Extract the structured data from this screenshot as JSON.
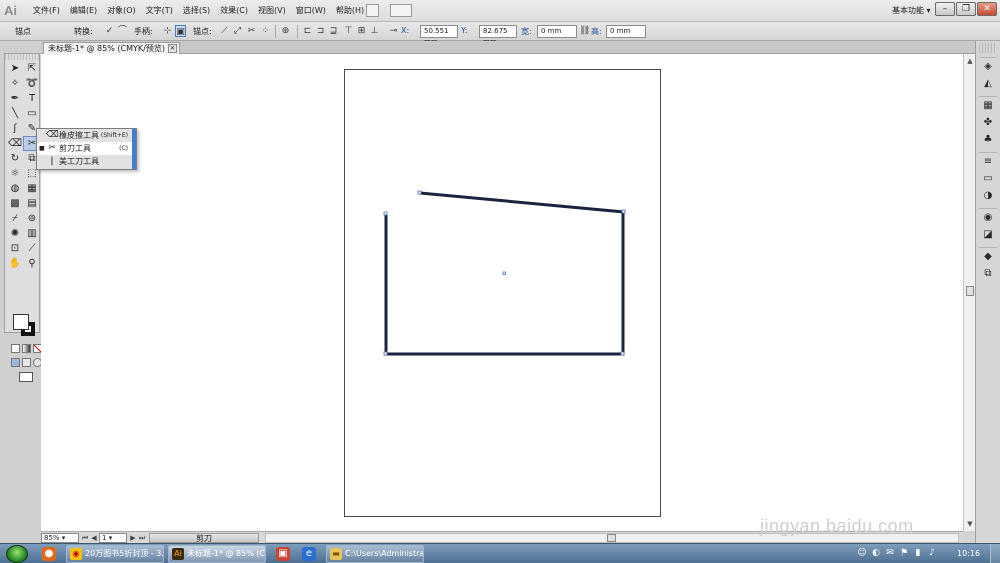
{
  "app": {
    "logo": "Ai",
    "workspace": "基本功能"
  },
  "menu": [
    "文件(F)",
    "编辑(E)",
    "对象(O)",
    "文字(T)",
    "选择(S)",
    "效果(C)",
    "视图(V)",
    "窗口(W)",
    "帮助(H)"
  ],
  "control_bar": {
    "mode_label": "锚点",
    "convert_label": "转换:",
    "handles_label": "手柄:",
    "anchors_label": "锚点:",
    "x_label": "X:",
    "x_value": "50.551 mm",
    "y_label": "Y:",
    "y_value": "82.675 mm",
    "w_label": "宽:",
    "w_value": "0 mm",
    "h_label": "高:",
    "h_value": "0 mm"
  },
  "document_tab": {
    "title": "未标题-1* @ 85% (CMYK/预览)"
  },
  "tool_flyout": {
    "items": [
      {
        "label": "橡皮擦工具",
        "shortcut": "(Shift+E)",
        "icon": "eraser-icon",
        "checked": false
      },
      {
        "label": "剪刀工具",
        "shortcut": "(C)",
        "icon": "scissors-icon",
        "checked": true
      },
      {
        "label": "美工刀工具",
        "shortcut": "",
        "icon": "knife-icon",
        "checked": false
      }
    ]
  },
  "status_bar": {
    "zoom": "85%",
    "page": "1",
    "tool_name": "剪刀"
  },
  "watermark": "jingyan.baidu.com",
  "taskbar": {
    "tasks": [
      {
        "label": "20万图书5折封顶 - 3...",
        "icon": "chrome-icon"
      },
      {
        "label": "未标题-1* @ 85% (C...",
        "icon": "illustrator-icon"
      },
      {
        "label": "C:\\Users\\Administrat...",
        "icon": "folder-icon"
      }
    ],
    "clock": "10:16"
  },
  "colors": {
    "path_stroke": "#1b2340",
    "selection": "#4a6fb0",
    "flyout_accent": "#3e7fd1",
    "taskbar": "#5d7fa3"
  }
}
